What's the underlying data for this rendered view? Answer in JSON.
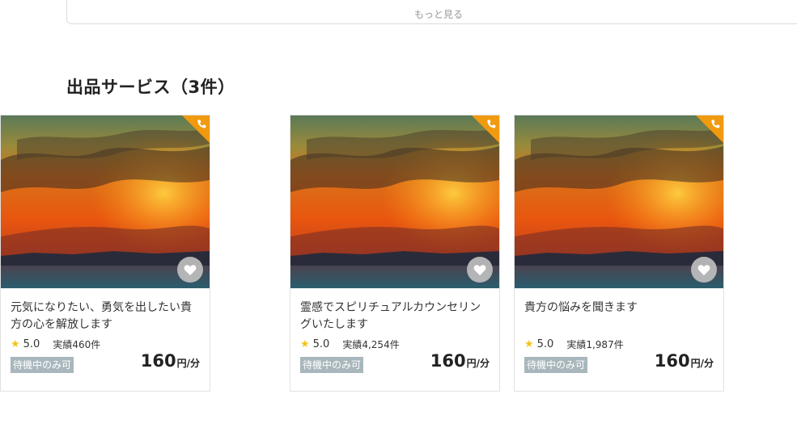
{
  "top_box": {
    "more_label": "もっと見る"
  },
  "section": {
    "title": "出品サービス（3件）"
  },
  "cards": [
    {
      "title": "霊感でスピリチュアルカウンセリングいたします",
      "rating": "5.0",
      "record": "実績4,254件",
      "badge": "待機中のみ可",
      "price": "160",
      "unit": "円/分"
    },
    {
      "title": "貴方の悩みを聞きます",
      "rating": "5.0",
      "record": "実績1,987件",
      "badge": "待機中のみ可",
      "price": "160",
      "unit": "円/分"
    },
    {
      "title": "元気になりたい、勇気を出したい貴方の心を解放します",
      "rating": "5.0",
      "record": "実績460件",
      "badge": "待機中のみ可",
      "price": "160",
      "unit": "円/分"
    }
  ],
  "colors": {
    "corner_accent": "#f09a10",
    "badge_bg": "#a9b7bd",
    "star": "#f5c518"
  },
  "icons": {
    "corner": "phone-icon",
    "favorite": "heart-icon",
    "rating": "star-icon"
  }
}
